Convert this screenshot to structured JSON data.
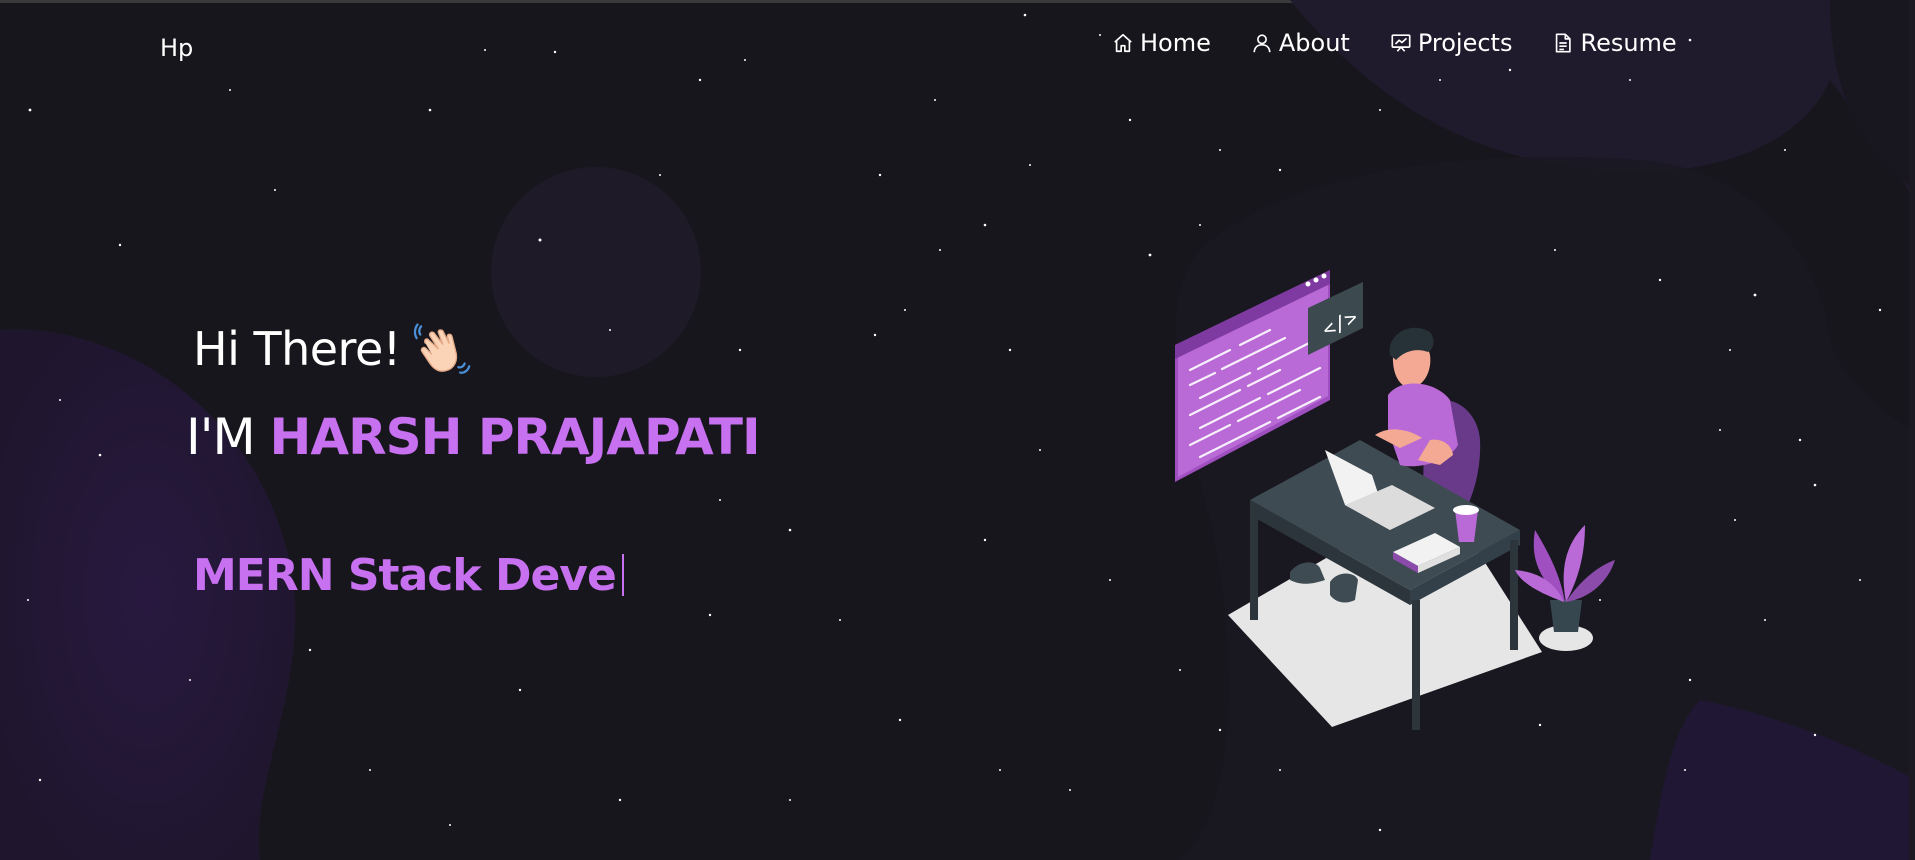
{
  "brand": {
    "logo": "Hp"
  },
  "nav": {
    "items": [
      {
        "label": "Home",
        "icon": "home-icon"
      },
      {
        "label": "About",
        "icon": "user-icon"
      },
      {
        "label": "Projects",
        "icon": "presentation-icon"
      },
      {
        "label": "Resume",
        "icon": "document-icon"
      }
    ]
  },
  "hero": {
    "greeting": "Hi There!",
    "name_prefix": "I'M ",
    "name": "HARSH PRAJAPATI",
    "typed_text": "MERN Stack Deve"
  },
  "colors": {
    "background": "#17161c",
    "accent": "#c770f0",
    "blob": "#2a1b45"
  }
}
